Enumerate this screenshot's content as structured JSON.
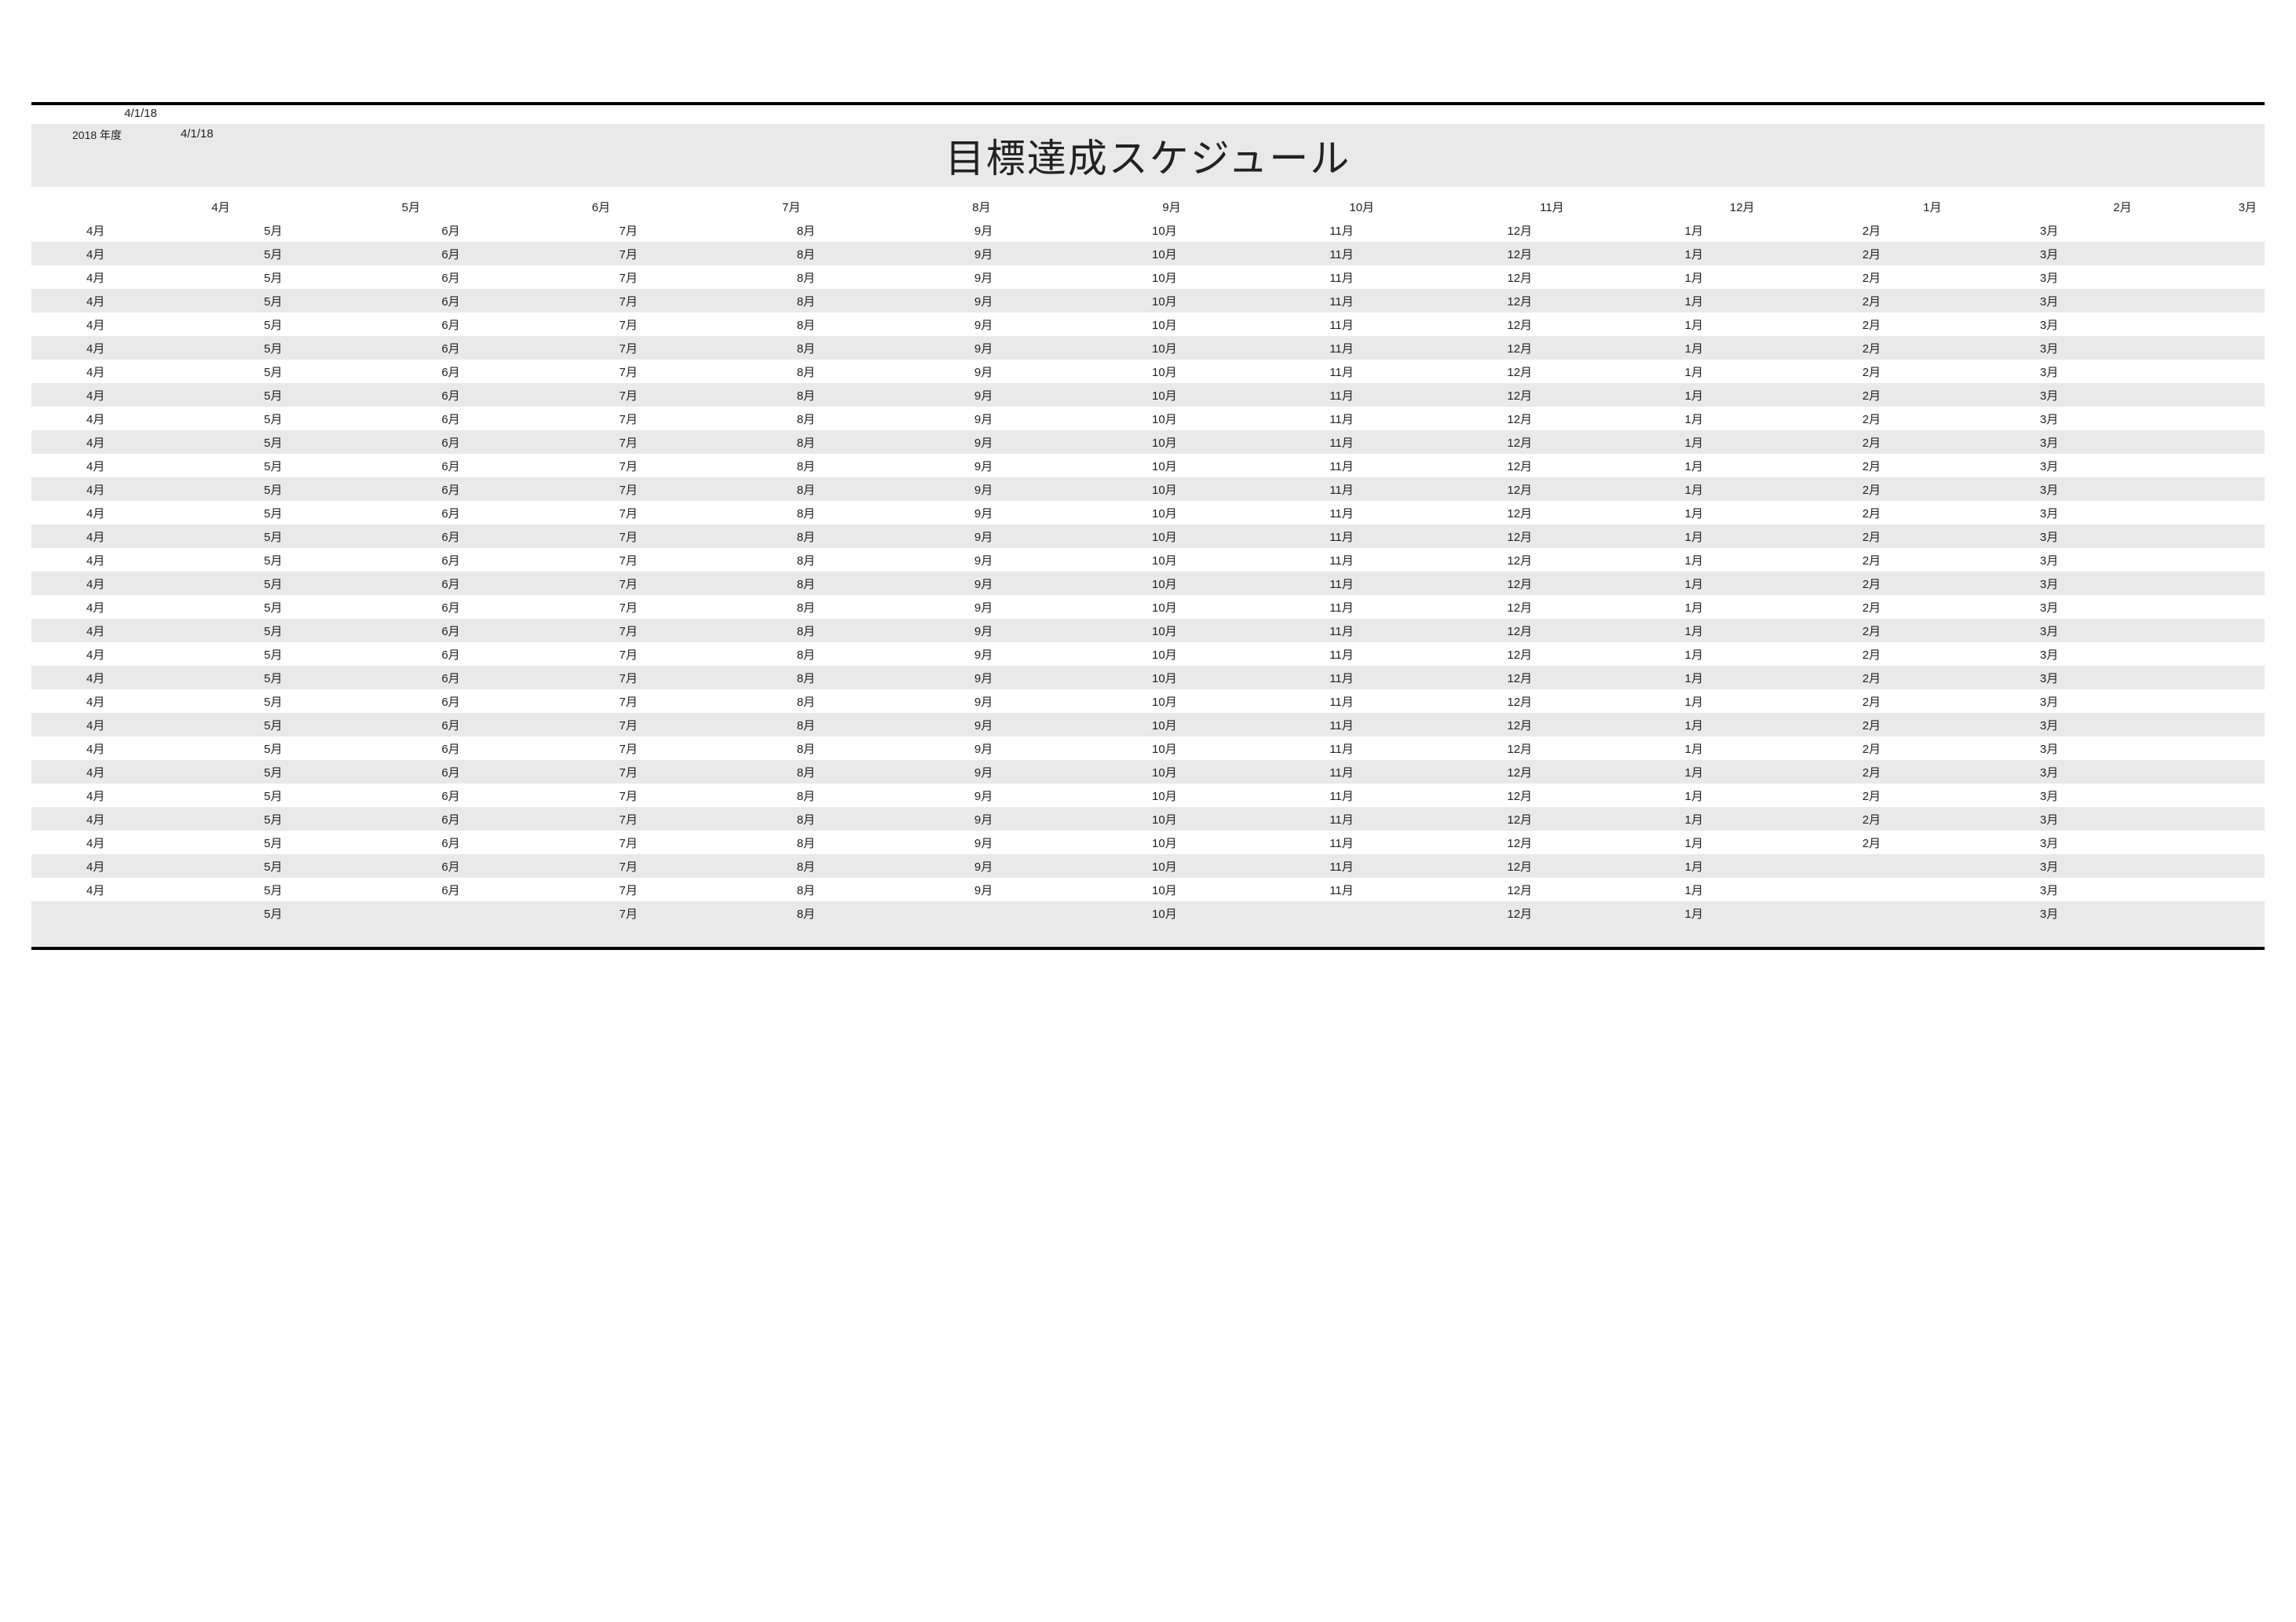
{
  "header": {
    "topDate1": "4/1/18",
    "yearLabel": "2018 年度",
    "topDate2": "4/1/18",
    "title": "目標達成スケジュール"
  },
  "columns": {
    "header": [
      "4月",
      "5月",
      "6月",
      "7月",
      "8月",
      "9月",
      "10月",
      "11月",
      "12月",
      "1月",
      "2月",
      "3月"
    ],
    "months": [
      "4月",
      "5月",
      "6月",
      "7月",
      "8月",
      "9月",
      "10月",
      "11月",
      "12月",
      "1月",
      "2月",
      "3月"
    ]
  },
  "rows": [
    {
      "cells": [
        "4月",
        "5月",
        "6月",
        "7月",
        "8月",
        "9月",
        "10月",
        "11月",
        "12月",
        "1月",
        "2月",
        "3月"
      ]
    },
    {
      "cells": [
        "4月",
        "5月",
        "6月",
        "7月",
        "8月",
        "9月",
        "10月",
        "11月",
        "12月",
        "1月",
        "2月",
        "3月"
      ]
    },
    {
      "cells": [
        "4月",
        "5月",
        "6月",
        "7月",
        "8月",
        "9月",
        "10月",
        "11月",
        "12月",
        "1月",
        "2月",
        "3月"
      ]
    },
    {
      "cells": [
        "4月",
        "5月",
        "6月",
        "7月",
        "8月",
        "9月",
        "10月",
        "11月",
        "12月",
        "1月",
        "2月",
        "3月"
      ]
    },
    {
      "cells": [
        "4月",
        "5月",
        "6月",
        "7月",
        "8月",
        "9月",
        "10月",
        "11月",
        "12月",
        "1月",
        "2月",
        "3月"
      ]
    },
    {
      "cells": [
        "4月",
        "5月",
        "6月",
        "7月",
        "8月",
        "9月",
        "10月",
        "11月",
        "12月",
        "1月",
        "2月",
        "3月"
      ]
    },
    {
      "cells": [
        "4月",
        "5月",
        "6月",
        "7月",
        "8月",
        "9月",
        "10月",
        "11月",
        "12月",
        "1月",
        "2月",
        "3月"
      ]
    },
    {
      "cells": [
        "4月",
        "5月",
        "6月",
        "7月",
        "8月",
        "9月",
        "10月",
        "11月",
        "12月",
        "1月",
        "2月",
        "3月"
      ]
    },
    {
      "cells": [
        "4月",
        "5月",
        "6月",
        "7月",
        "8月",
        "9月",
        "10月",
        "11月",
        "12月",
        "1月",
        "2月",
        "3月"
      ]
    },
    {
      "cells": [
        "4月",
        "5月",
        "6月",
        "7月",
        "8月",
        "9月",
        "10月",
        "11月",
        "12月",
        "1月",
        "2月",
        "3月"
      ]
    },
    {
      "cells": [
        "4月",
        "5月",
        "6月",
        "7月",
        "8月",
        "9月",
        "10月",
        "11月",
        "12月",
        "1月",
        "2月",
        "3月"
      ]
    },
    {
      "cells": [
        "4月",
        "5月",
        "6月",
        "7月",
        "8月",
        "9月",
        "10月",
        "11月",
        "12月",
        "1月",
        "2月",
        "3月"
      ]
    },
    {
      "cells": [
        "4月",
        "5月",
        "6月",
        "7月",
        "8月",
        "9月",
        "10月",
        "11月",
        "12月",
        "1月",
        "2月",
        "3月"
      ]
    },
    {
      "cells": [
        "4月",
        "5月",
        "6月",
        "7月",
        "8月",
        "9月",
        "10月",
        "11月",
        "12月",
        "1月",
        "2月",
        "3月"
      ]
    },
    {
      "cells": [
        "4月",
        "5月",
        "6月",
        "7月",
        "8月",
        "9月",
        "10月",
        "11月",
        "12月",
        "1月",
        "2月",
        "3月"
      ]
    },
    {
      "cells": [
        "4月",
        "5月",
        "6月",
        "7月",
        "8月",
        "9月",
        "10月",
        "11月",
        "12月",
        "1月",
        "2月",
        "3月"
      ]
    },
    {
      "cells": [
        "4月",
        "5月",
        "6月",
        "7月",
        "8月",
        "9月",
        "10月",
        "11月",
        "12月",
        "1月",
        "2月",
        "3月"
      ]
    },
    {
      "cells": [
        "4月",
        "5月",
        "6月",
        "7月",
        "8月",
        "9月",
        "10月",
        "11月",
        "12月",
        "1月",
        "2月",
        "3月"
      ]
    },
    {
      "cells": [
        "4月",
        "5月",
        "6月",
        "7月",
        "8月",
        "9月",
        "10月",
        "11月",
        "12月",
        "1月",
        "2月",
        "3月"
      ]
    },
    {
      "cells": [
        "4月",
        "5月",
        "6月",
        "7月",
        "8月",
        "9月",
        "10月",
        "11月",
        "12月",
        "1月",
        "2月",
        "3月"
      ]
    },
    {
      "cells": [
        "4月",
        "5月",
        "6月",
        "7月",
        "8月",
        "9月",
        "10月",
        "11月",
        "12月",
        "1月",
        "2月",
        "3月"
      ]
    },
    {
      "cells": [
        "4月",
        "5月",
        "6月",
        "7月",
        "8月",
        "9月",
        "10月",
        "11月",
        "12月",
        "1月",
        "2月",
        "3月"
      ]
    },
    {
      "cells": [
        "4月",
        "5月",
        "6月",
        "7月",
        "8月",
        "9月",
        "10月",
        "11月",
        "12月",
        "1月",
        "2月",
        "3月"
      ]
    },
    {
      "cells": [
        "4月",
        "5月",
        "6月",
        "7月",
        "8月",
        "9月",
        "10月",
        "11月",
        "12月",
        "1月",
        "2月",
        "3月"
      ]
    },
    {
      "cells": [
        "4月",
        "5月",
        "6月",
        "7月",
        "8月",
        "9月",
        "10月",
        "11月",
        "12月",
        "1月",
        "2月",
        "3月"
      ]
    },
    {
      "cells": [
        "4月",
        "5月",
        "6月",
        "7月",
        "8月",
        "9月",
        "10月",
        "11月",
        "12月",
        "1月",
        "2月",
        "3月"
      ]
    },
    {
      "cells": [
        "4月",
        "5月",
        "6月",
        "7月",
        "8月",
        "9月",
        "10月",
        "11月",
        "12月",
        "1月",
        "2月",
        "3月"
      ]
    },
    {
      "cells": [
        "4月",
        "5月",
        "6月",
        "7月",
        "8月",
        "9月",
        "10月",
        "11月",
        "12月",
        "1月",
        "",
        "3月"
      ]
    },
    {
      "cells": [
        "4月",
        "5月",
        "6月",
        "7月",
        "8月",
        "9月",
        "10月",
        "11月",
        "12月",
        "1月",
        "",
        "3月"
      ]
    },
    {
      "cells": [
        "",
        "5月",
        "",
        "7月",
        "8月",
        "",
        "10月",
        "",
        "12月",
        "1月",
        "",
        "3月"
      ]
    }
  ]
}
